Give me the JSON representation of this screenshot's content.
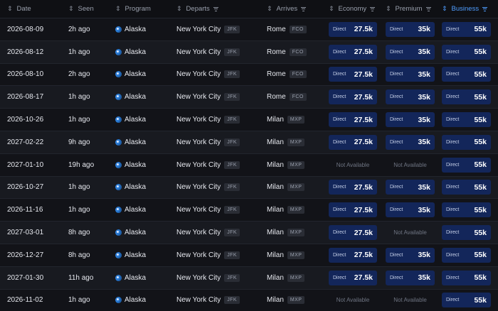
{
  "headers": {
    "date": "Date",
    "seen": "Seen",
    "program": "Program",
    "departs": "Departs",
    "arrives": "Arrives",
    "economy": "Economy",
    "premium": "Premium",
    "business": "Business",
    "sort_glyph": "⇕"
  },
  "labels": {
    "direct": "Direct",
    "not_available": "Not Available"
  },
  "colors": {
    "accent": "#4f9dff",
    "fare_bg": "#13265a",
    "program_icon": "#2b7bd3"
  },
  "rows": [
    {
      "date": "2026-08-09",
      "seen": "2h ago",
      "program": "Alaska",
      "dep_city": "New York City",
      "dep_code": "JFK",
      "arr_city": "Rome",
      "arr_code": "FCO",
      "economy": "27.5k",
      "premium": "35k",
      "business": "55k"
    },
    {
      "date": "2026-08-12",
      "seen": "1h ago",
      "program": "Alaska",
      "dep_city": "New York City",
      "dep_code": "JFK",
      "arr_city": "Rome",
      "arr_code": "FCO",
      "economy": "27.5k",
      "premium": "35k",
      "business": "55k"
    },
    {
      "date": "2026-08-10",
      "seen": "2h ago",
      "program": "Alaska",
      "dep_city": "New York City",
      "dep_code": "JFK",
      "arr_city": "Rome",
      "arr_code": "FCO",
      "economy": "27.5k",
      "premium": "35k",
      "business": "55k"
    },
    {
      "date": "2026-08-17",
      "seen": "1h ago",
      "program": "Alaska",
      "dep_city": "New York City",
      "dep_code": "JFK",
      "arr_city": "Rome",
      "arr_code": "FCO",
      "economy": "27.5k",
      "premium": "35k",
      "business": "55k"
    },
    {
      "date": "2026-10-26",
      "seen": "1h ago",
      "program": "Alaska",
      "dep_city": "New York City",
      "dep_code": "JFK",
      "arr_city": "Milan",
      "arr_code": "MXP",
      "economy": "27.5k",
      "premium": "35k",
      "business": "55k"
    },
    {
      "date": "2027-02-22",
      "seen": "9h ago",
      "program": "Alaska",
      "dep_city": "New York City",
      "dep_code": "JFK",
      "arr_city": "Milan",
      "arr_code": "MXP",
      "economy": "27.5k",
      "premium": "35k",
      "business": "55k"
    },
    {
      "date": "2027-01-10",
      "seen": "19h ago",
      "program": "Alaska",
      "dep_city": "New York City",
      "dep_code": "JFK",
      "arr_city": "Milan",
      "arr_code": "MXP",
      "economy": null,
      "premium": null,
      "business": "55k"
    },
    {
      "date": "2026-10-27",
      "seen": "1h ago",
      "program": "Alaska",
      "dep_city": "New York City",
      "dep_code": "JFK",
      "arr_city": "Milan",
      "arr_code": "MXP",
      "economy": "27.5k",
      "premium": "35k",
      "business": "55k"
    },
    {
      "date": "2026-11-16",
      "seen": "1h ago",
      "program": "Alaska",
      "dep_city": "New York City",
      "dep_code": "JFK",
      "arr_city": "Milan",
      "arr_code": "MXP",
      "economy": "27.5k",
      "premium": "35k",
      "business": "55k"
    },
    {
      "date": "2027-03-01",
      "seen": "8h ago",
      "program": "Alaska",
      "dep_city": "New York City",
      "dep_code": "JFK",
      "arr_city": "Milan",
      "arr_code": "MXP",
      "economy": "27.5k",
      "premium": null,
      "business": "55k"
    },
    {
      "date": "2026-12-27",
      "seen": "8h ago",
      "program": "Alaska",
      "dep_city": "New York City",
      "dep_code": "JFK",
      "arr_city": "Milan",
      "arr_code": "MXP",
      "economy": "27.5k",
      "premium": "35k",
      "business": "55k"
    },
    {
      "date": "2027-01-30",
      "seen": "11h ago",
      "program": "Alaska",
      "dep_city": "New York City",
      "dep_code": "JFK",
      "arr_city": "Milan",
      "arr_code": "MXP",
      "economy": "27.5k",
      "premium": "35k",
      "business": "55k"
    },
    {
      "date": "2026-11-02",
      "seen": "1h ago",
      "program": "Alaska",
      "dep_city": "New York City",
      "dep_code": "JFK",
      "arr_city": "Milan",
      "arr_code": "MXP",
      "economy": null,
      "premium": null,
      "business": "55k"
    }
  ]
}
